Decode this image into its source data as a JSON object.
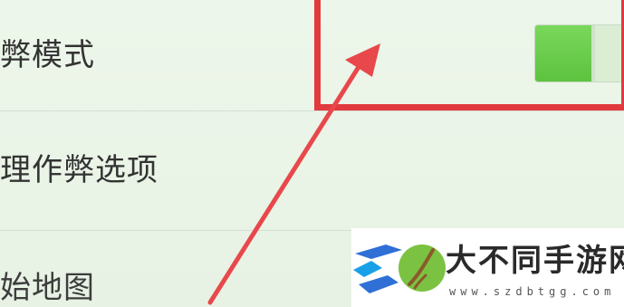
{
  "settings": {
    "rows": [
      {
        "label": "弊模式",
        "toggle": {
          "state": "on"
        }
      },
      {
        "label": "理作弊选项"
      },
      {
        "label": "始地图"
      }
    ]
  },
  "annotation": {
    "highlight_color": "#e13a3e",
    "arrow_color": "#e8484c",
    "target": "toggle"
  },
  "colors": {
    "toggle_on": "#6acb4b",
    "background": "#eaf4e8"
  },
  "watermark": {
    "title": "大不同手游网",
    "url": "www.szdbtgg.com",
    "logo_icon": "leaf-swoosh-logo"
  }
}
